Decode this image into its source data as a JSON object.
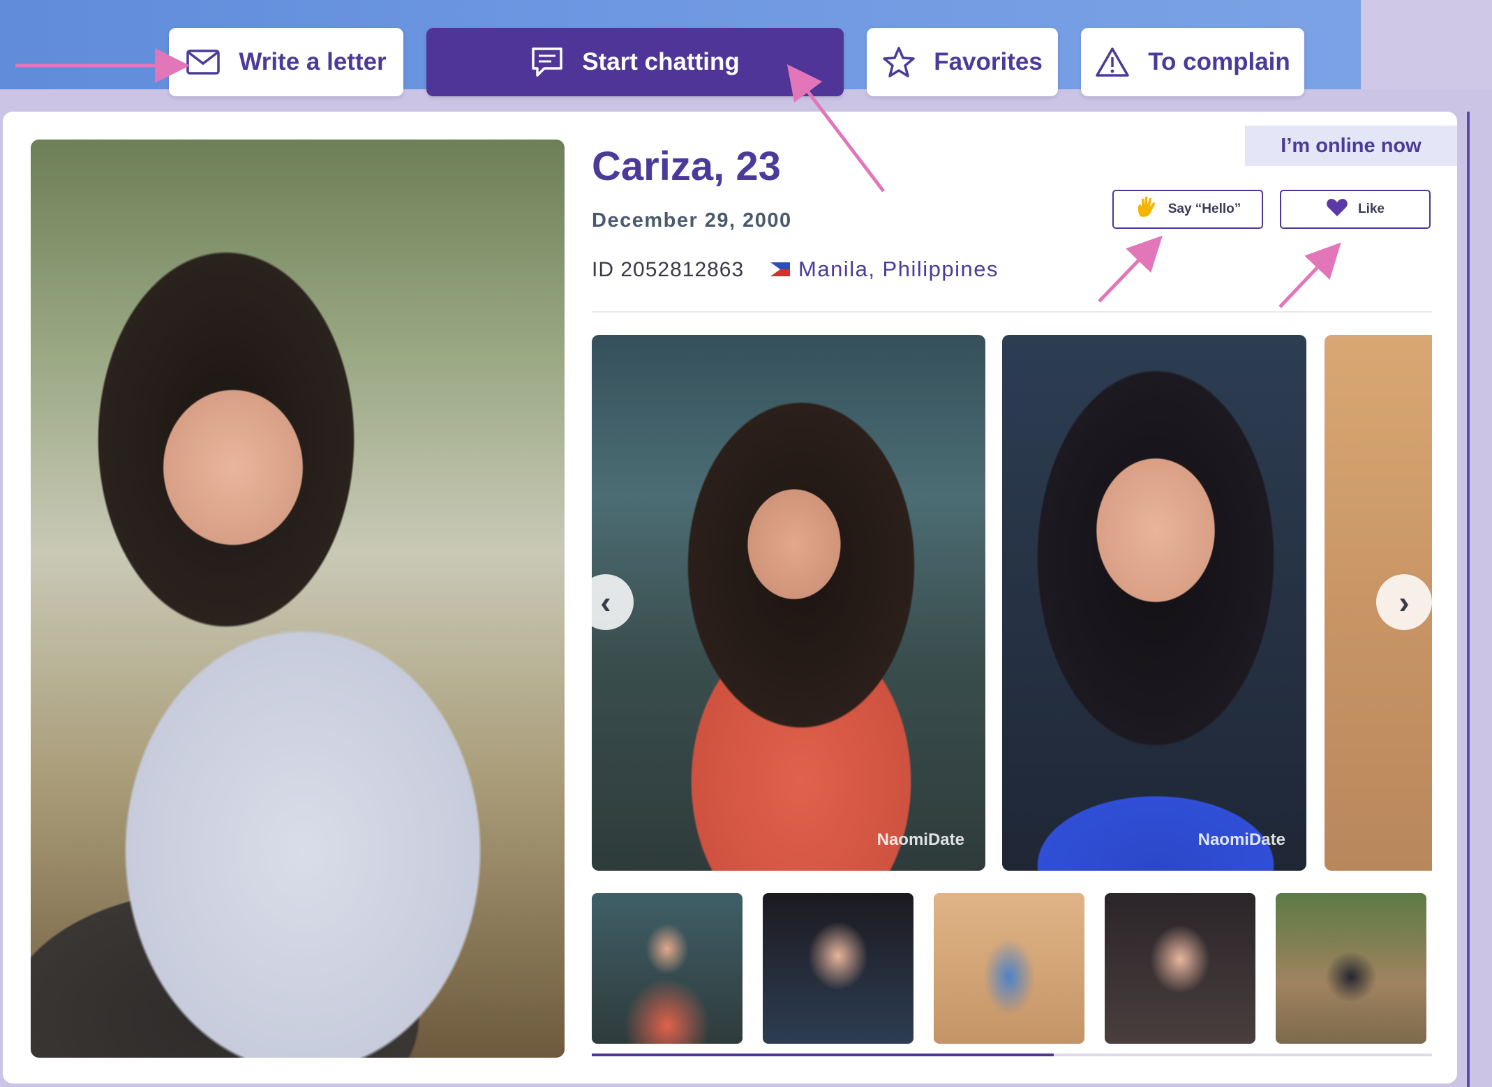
{
  "action_bar": {
    "write_letter": "Write a letter",
    "start_chatting": "Start chatting",
    "favorites": "Favorites",
    "complain": "To complain"
  },
  "profile": {
    "name_age": "Cariza, 23",
    "birth_date": "December 29, 2000",
    "id_text": "ID 2052812863",
    "location": "Manila, Philippines",
    "online_status": "I’m online now"
  },
  "reactions": {
    "say_hello": "Say “Hello”",
    "like": "Like"
  },
  "gallery": {
    "watermark": "NaomiDate",
    "thumbnail_count": 5,
    "progress_fraction": 0.55
  },
  "colors": {
    "brand_purple": "#4f3597",
    "title_purple": "#4b3a9a",
    "annotation_pink": "#e276b8"
  },
  "icons": {
    "write_letter": "envelope-icon",
    "start_chatting": "chat-bubble-icon",
    "favorites": "star-icon",
    "complain": "warning-icon",
    "say_hello": "waving-hand-icon",
    "like": "heart-icon",
    "prev": "chevron-left-icon",
    "next": "chevron-right-icon"
  }
}
